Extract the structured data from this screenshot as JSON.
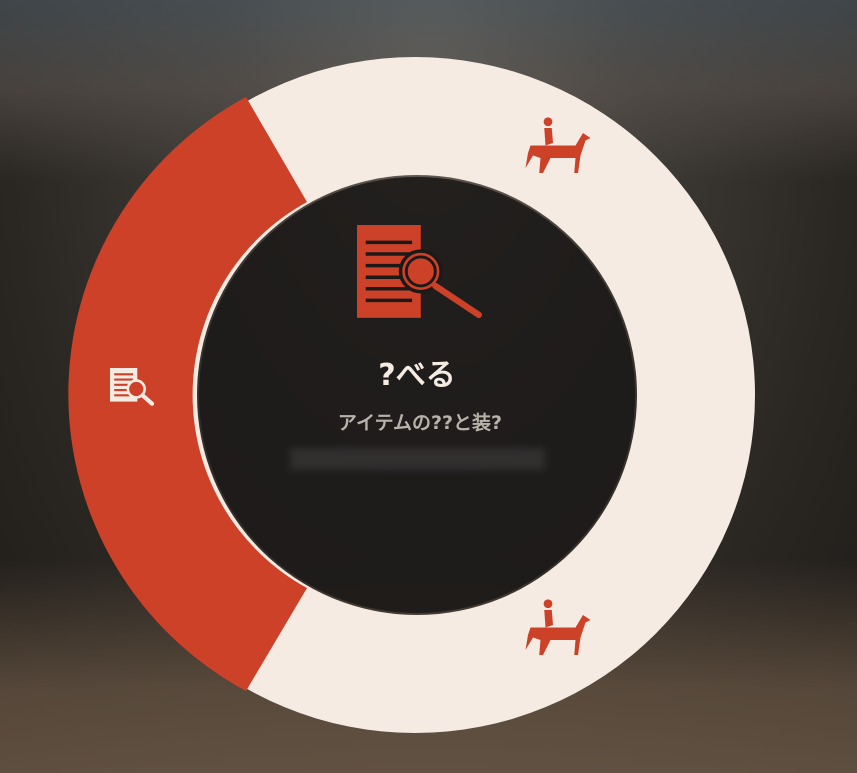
{
  "menu": {
    "selected": {
      "title": "?べる",
      "description": "アイテムの??と装?",
      "icon": "document-search-icon"
    },
    "segments": [
      {
        "name": "inspect",
        "icon": "document-search-icon",
        "selected": true
      },
      {
        "name": "ride-top",
        "icon": "horse-rider-icon",
        "selected": false
      },
      {
        "name": "ride-bottom",
        "icon": "horse-rider-icon",
        "selected": false
      }
    ],
    "colors": {
      "accent": "#cd4128",
      "ring": "#f6ebe3",
      "center": "#1c1a18"
    }
  }
}
